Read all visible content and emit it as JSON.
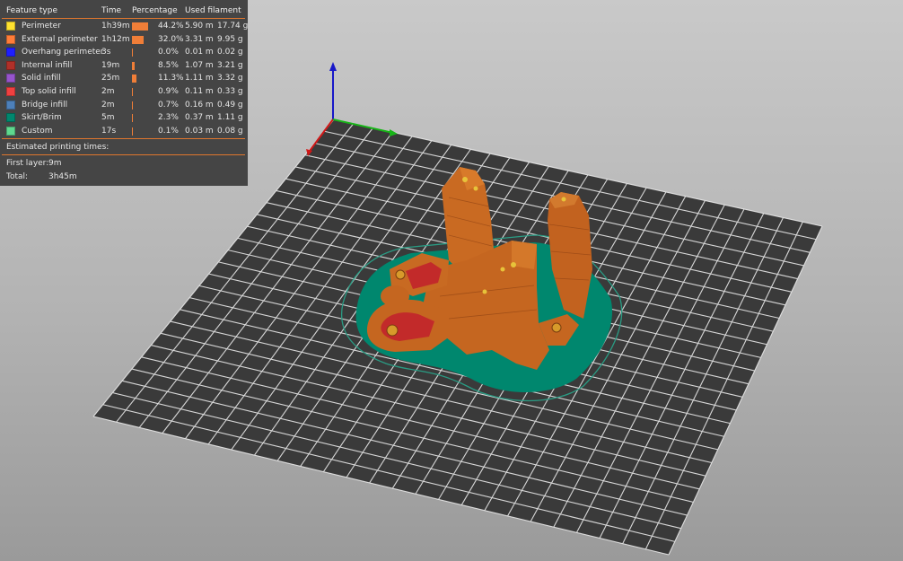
{
  "legend": {
    "headers": {
      "feature_type": "Feature type",
      "time": "Time",
      "percentage": "Percentage",
      "used_filament": "Used filament"
    },
    "rows": [
      {
        "name": "Perimeter",
        "time": "1h39m",
        "percent": "44.2%",
        "percent_value": 44.2,
        "length": "5.90 m",
        "weight": "17.74 g",
        "color": "#ffe22f"
      },
      {
        "name": "External perimeter",
        "time": "1h12m",
        "percent": "32.0%",
        "percent_value": 32.0,
        "length": "3.31 m",
        "weight": "9.95 g",
        "color": "#ff7d38"
      },
      {
        "name": "Overhang perimeter",
        "time": "3s",
        "percent": "0.0%",
        "percent_value": 0.0,
        "length": "0.01 m",
        "weight": "0.02 g",
        "color": "#1f1fff"
      },
      {
        "name": "Internal infill",
        "time": "19m",
        "percent": "8.5%",
        "percent_value": 8.5,
        "length": "1.07 m",
        "weight": "3.21 g",
        "color": "#b03029"
      },
      {
        "name": "Solid infill",
        "time": "25m",
        "percent": "11.3%",
        "percent_value": 11.3,
        "length": "1.11 m",
        "weight": "3.32 g",
        "color": "#9654cc"
      },
      {
        "name": "Top solid infill",
        "time": "2m",
        "percent": "0.9%",
        "percent_value": 0.9,
        "length": "0.11 m",
        "weight": "0.33 g",
        "color": "#f04040"
      },
      {
        "name": "Bridge infill",
        "time": "2m",
        "percent": "0.7%",
        "percent_value": 0.7,
        "length": "0.16 m",
        "weight": "0.49 g",
        "color": "#4d80ba"
      },
      {
        "name": "Skirt/Brim",
        "time": "5m",
        "percent": "2.3%",
        "percent_value": 2.3,
        "length": "0.37 m",
        "weight": "1.11 g",
        "color": "#00876e"
      },
      {
        "name": "Custom",
        "time": "17s",
        "percent": "0.1%",
        "percent_value": 0.1,
        "length": "0.03 m",
        "weight": "0.08 g",
        "color": "#5ed88f"
      }
    ],
    "estimated_label": "Estimated printing times:",
    "first_layer_label": "First layer:",
    "first_layer_value": "9m",
    "total_label": "Total:",
    "total_value": "3h45m",
    "bar_color": "#f07e38"
  },
  "scene": {
    "bed_color": "#3a3a3a",
    "grid_color": "#e8e8e8",
    "axis_x_color": "#d01818",
    "axis_y_color": "#18b418",
    "axis_z_color": "#1818c8",
    "model_color": "#c96a22",
    "brim_color": "#00876e"
  }
}
